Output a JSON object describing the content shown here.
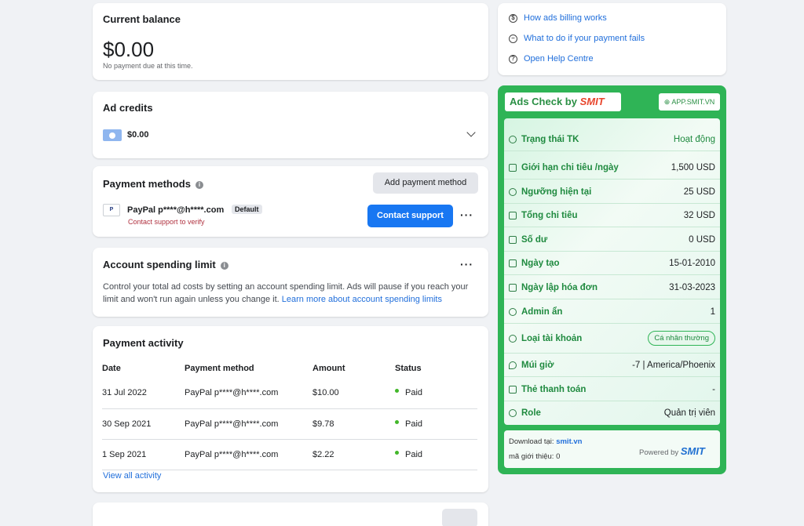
{
  "balance": {
    "title": "Current balance",
    "amount": "$0.00",
    "note": "No payment due at this time."
  },
  "ad_credits": {
    "title": "Ad credits",
    "amount": "$0.00"
  },
  "payment_methods": {
    "title": "Payment methods",
    "add_button": "Add payment method",
    "method_name": "PayPal p****@h****.com",
    "default_badge": "Default",
    "verify_note": "Contact support to verify",
    "contact_button": "Contact support",
    "more_label": "···"
  },
  "spending_limit": {
    "title": "Account spending limit",
    "description": "Control your total ad costs by setting an account spending limit. Ads will pause if you reach your limit and won't run again unless you change it.",
    "learn_more": "Learn more about account spending limits",
    "more_label": "···"
  },
  "payment_activity": {
    "title": "Payment activity",
    "headers": {
      "date": "Date",
      "method": "Payment method",
      "amount": "Amount",
      "status": "Status"
    },
    "rows": [
      {
        "date": "31 Jul 2022",
        "method": "PayPal p****@h****.com",
        "amount": "$10.00",
        "status": "Paid"
      },
      {
        "date": "30 Sep 2021",
        "method": "PayPal p****@h****.com",
        "amount": "$9.78",
        "status": "Paid"
      },
      {
        "date": "1 Sep 2021",
        "method": "PayPal p****@h****.com",
        "amount": "$2.22",
        "status": "Paid"
      }
    ],
    "view_all": "View all activity"
  },
  "help_links": [
    "How ads billing works",
    "What to do if your payment fails",
    "Open Help Centre"
  ],
  "smit": {
    "header_prefix": "Ads Check by ",
    "brand": "SMIT",
    "site": "APP.SMIT.VN",
    "rows": [
      {
        "label": "Trạng thái TK",
        "value": "Hoạt động"
      },
      {
        "label": "Giới hạn chi tiêu /ngày",
        "value": "1,500 USD"
      },
      {
        "label": "Ngưỡng hiện tại",
        "value": "25 USD"
      },
      {
        "label": "Tổng chi tiêu",
        "value": "32 USD"
      },
      {
        "label": "Số dư",
        "value": "0 USD"
      },
      {
        "label": "Ngày tạo",
        "value": "15-01-2010"
      },
      {
        "label": "Ngày lập hóa đơn",
        "value": "31-03-2023"
      },
      {
        "label": "Admin ẩn",
        "value": "1"
      },
      {
        "label": "Loại tài khoản",
        "value": "Cá nhân thường"
      },
      {
        "label": "Múi giờ",
        "value": "-7 | America/Phoenix"
      },
      {
        "label": "Thẻ thanh toán",
        "value": "-"
      },
      {
        "label": "Role",
        "value": "Quản trị viên"
      }
    ],
    "download_label": "Download tại: ",
    "download_site": "smit.vn",
    "referral": "mã giới thiệu: 0",
    "powered_by": "Powered by",
    "powered_brand": "SMIT"
  },
  "colors": {
    "primary": "#1877f2",
    "link": "#216fdb",
    "smit_green": "#2fb456"
  }
}
